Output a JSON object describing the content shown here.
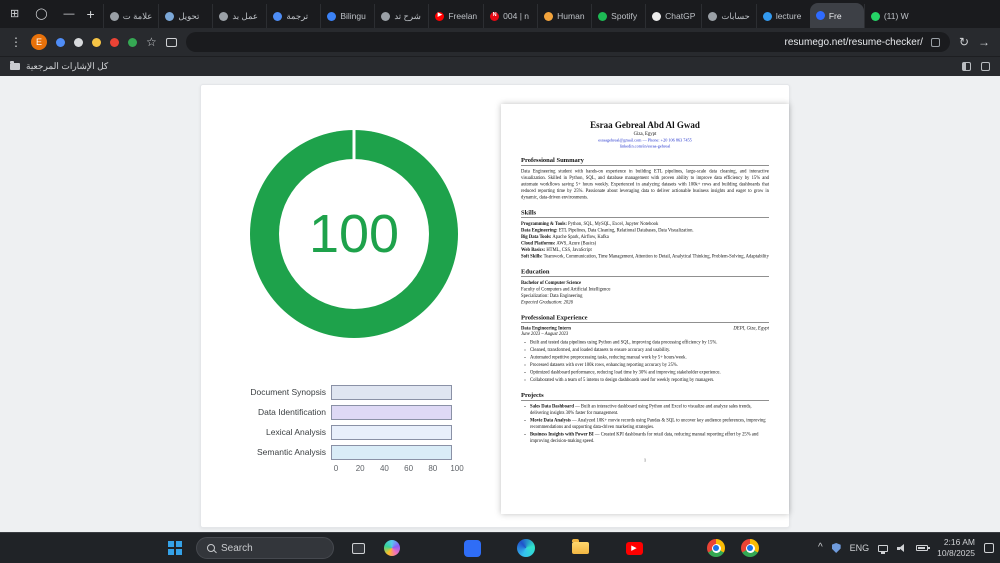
{
  "browser": {
    "profile_initial": "E",
    "url": "resumego.net/resume-checker/",
    "bookmarks_label": "كل الإشارات المرجعية",
    "tabs": [
      {
        "label": "علامة ت",
        "icon": "page-icon",
        "icon_style": "background:#9aa0a6"
      },
      {
        "label": "تحويل",
        "icon": "converter-site-icon",
        "icon_style": "background:#7ba7d7"
      },
      {
        "label": "عمل بد",
        "icon": "document-site-icon",
        "icon_style": "background:#9aa0a6"
      },
      {
        "label": "ترجمة",
        "icon": "google-translate-icon",
        "icon_style": "background:#4e8df5"
      },
      {
        "label": "Bilingu",
        "icon": "video-site-icon",
        "icon_style": "background:#3b82f6"
      },
      {
        "label": "شرح تد",
        "icon": "page-icon",
        "icon_style": "background:#9aa0a6"
      },
      {
        "label": "Freelan",
        "icon": "youtube-icon",
        "icon_style": "background:#ff0000",
        "glyph": "▶"
      },
      {
        "label": "004 | n",
        "icon": "netflix-icon",
        "icon_style": "background:#e50914",
        "glyph": "N"
      },
      {
        "label": "Human",
        "icon": "site-icon",
        "icon_style": "background:#f2a33c"
      },
      {
        "label": "Spotify",
        "icon": "spotify-icon",
        "icon_style": "background:#1db954"
      },
      {
        "label": "ChatGP",
        "icon": "chatgpt-icon",
        "icon_style": "background:#ececec"
      },
      {
        "label": "حسابات",
        "icon": "site-icon",
        "icon_style": "background:#9aa0a6"
      },
      {
        "label": "lecture",
        "icon": "cloud-icon",
        "icon_style": "background:#339af0"
      },
      {
        "label": "Fre",
        "icon": "resumego-icon",
        "icon_style": "background:#2f6bff",
        "active": true
      },
      {
        "label": "(11) W",
        "icon": "whatsapp-icon",
        "icon_style": "background:#25d366"
      }
    ]
  },
  "glyphs": {
    "menu": "⋮",
    "star": "☆",
    "reload": "↻",
    "back": "→",
    "new_tab": "+",
    "minimize": "—",
    "maximize": "⊞",
    "tab_circle": "◯",
    "chevron_up": "^",
    "play": "▶"
  },
  "chart_data": {
    "type": "bar",
    "orientation": "horizontal",
    "score": 100,
    "score_color": "#1ea24b",
    "categories": [
      "Document Synopsis",
      "Data Identification",
      "Lexical Analysis",
      "Semantic Analysis"
    ],
    "values": [
      100,
      100,
      100,
      100
    ],
    "xlim": [
      0,
      100
    ],
    "ticks": [
      0,
      20,
      40,
      60,
      80,
      100
    ],
    "bar_colors": [
      "#dfe5f1",
      "#ded9f5",
      "#e8effb",
      "#d9ecf7"
    ],
    "bar_border_color": "#8a91a6",
    "grid": false,
    "legend": false
  },
  "resume": {
    "name": "Esraa Gebreal Abd Al Gwad",
    "location": "Giza, Egypt",
    "contact_line1": "esraagebreal@gmail.com — Phone: +20 106 863 7455",
    "contact_line2": "linkedin.com/in/esraa-gebreal",
    "summary_title": "Professional Summary",
    "summary_body": "Data Engineering student with hands-on experience in building ETL pipelines, large-scale data cleaning, and interactive visualization. Skilled in Python, SQL, and database management with proven ability to improve data efficiency by 15% and automate workflows saving 5+ hours weekly. Experienced in analyzing datasets with 100k+ rows and building dashboards that reduced reporting time by 25%. Passionate about leveraging data to deliver actionable business insights and eager to grow in dynamic, data-driven environments.",
    "skills_title": "Skills",
    "skills": [
      {
        "k": "Programming & Tools:",
        "v": "Python, SQL, MySQL, Excel, Jupyter Notebook"
      },
      {
        "k": "Data Engineering:",
        "v": "ETL Pipelines, Data Cleaning, Relational Databases, Data Visualization."
      },
      {
        "k": "Big Data Tools:",
        "v": "Apache Spark, Airflow, Kafka"
      },
      {
        "k": "Cloud Platforms:",
        "v": "AWS, Azure (Basics)"
      },
      {
        "k": "Web Basics:",
        "v": "HTML, CSS, JavaScript"
      },
      {
        "k": "Soft Skills:",
        "v": "Teamwork, Communication, Time Management, Attention to Detail, Analytical Thinking, Problem-Solving, Adaptability"
      }
    ],
    "education_title": "Education",
    "education_degree": "Bachelor of Computer Science",
    "education_faculty": "Faculty of Computers and Artificial Intelligence",
    "education_specialization": "Specialization: Data Engineering",
    "education_graduation": "Expected Graduation: 2026",
    "experience_title": "Professional Experience",
    "experience_role": "Data Engineering Intern",
    "experience_org": "DEPI, Giza, Egypt",
    "experience_dates": "June 2023 – August 2023",
    "experience_bullets": [
      "Built and tested data pipelines using Python and SQL, improving data processing efficiency by 15%.",
      "Cleaned, transformed, and loaded datasets to ensure accuracy and usability.",
      "Automated repetitive preprocessing tasks, reducing manual work by 5+ hours/week.",
      "Processed datasets with over 100k rows, enhancing reporting accuracy by 25%.",
      "Optimized dashboard performance, reducing load time by 30% and improving stakeholder experience.",
      "Collaborated with a team of 5 interns to design dashboards used for weekly reporting by managers."
    ],
    "projects_title": "Projects",
    "projects": [
      {
        "name": "Sales Data Dashboard",
        "desc": "— Built an interactive dashboard using Python and Excel to visualize and analyze sales trends, delivering insights 30% faster for management."
      },
      {
        "name": "Movie Data Analysis",
        "desc": "— Analyzed 10K+ movie records using Pandas & SQL to uncover key audience preferences, improving recommendations and supporting data-driven marketing strategies."
      },
      {
        "name": "Business Insights with Power BI",
        "desc": "— Created KPI dashboards for retail data, reducing manual reporting effort by 25% and improving decision-making speed."
      }
    ],
    "page_number": "1"
  },
  "taskbar": {
    "search_label": "Search",
    "language": "ENG",
    "time": "2:16 AM",
    "date": "10/8/2025"
  }
}
